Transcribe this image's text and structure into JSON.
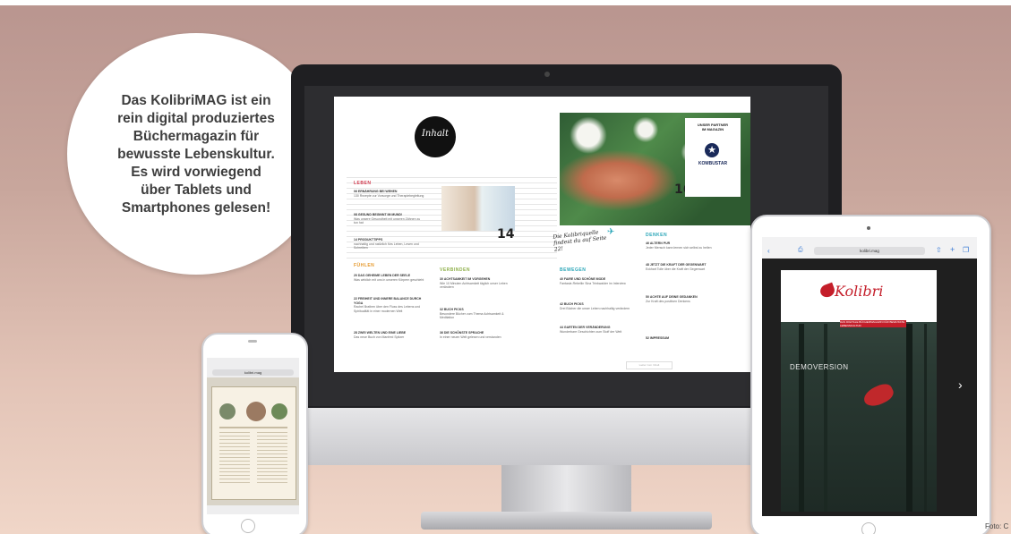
{
  "bubble": {
    "text": "Das KolibriMAG ist ein\nrein digital produziertes\nBüchermagazin für\nbewusste Lebenskultur.\nEs wird vorwiegend\nüber Tablets und\nSmartphones gelesen!"
  },
  "magazine": {
    "logo_text": "Inhalt",
    "sections": [
      {
        "label": "LEBEN",
        "color": "#d23b4f"
      },
      {
        "label": "FÜHLEN",
        "color": "#e69a2e"
      },
      {
        "label": "VERBINDEN",
        "color": "#8fb04b"
      },
      {
        "label": "BEWEGEN",
        "color": "#2aa6b8"
      },
      {
        "label": "DENKEN",
        "color": "#2aa6b8"
      }
    ],
    "page_numbers": [
      "14",
      "16"
    ],
    "partner_title": "UNSER PARTNER\nIM MAGAZIN",
    "partner_name": "KOMBUSTAR",
    "script_note": "Die Kolibriquelle findest du auf Seite 22!",
    "more_button": "weiter zum Inhalt",
    "toc_items": [
      {
        "num": "06",
        "title": "ERNÄHRUNG BEI WEHEN",
        "text": "130 Rezepte zur Vorsorge und Therapiebegleitung"
      },
      {
        "num": "08",
        "title": "GESUND BEGINNT IM MUND!",
        "text": "Was unsere Gesundheit mit unseren Zähnen zu tun hat"
      },
      {
        "num": "14",
        "title": "PRODUKTTIPPS",
        "text": "nachhaltig und natürlich fürs Leben, Lesen und Schreiben"
      },
      {
        "num": "20",
        "title": "DAS GEHEIME LEBEN DER SEELE",
        "text": "Was wirklich mit uns in unseren Körpern geschieht"
      },
      {
        "num": "22",
        "title": "FREIHEIT UND INNERE BALANCE DURCH YOGA",
        "text": "Rachel Brathen über den Fluss des Lebens und Spiritualität in einer modernen Welt"
      },
      {
        "num": "28",
        "title": "ZWEI WELTEN UND EINE LIEBE",
        "text": "Das neue Buch von Manfred Spitzer"
      },
      {
        "num": "30",
        "title": "ACHTSAMKEIT IM VORGEHEN",
        "text": "Wie 10 Minuten Achtsamkeit täglich unser Leben verändern"
      },
      {
        "num": "32",
        "title": "BUCH PICKS",
        "text": "Besondere Bücher zum Thema Achtsamkeit & Meditation"
      },
      {
        "num": "36",
        "title": "DIE SCHÖNSTE SPRACHE",
        "text": "In einer neuen Welt gelesen und verstanden"
      },
      {
        "num": "40",
        "title": "FAIRE UND SCHÖNE MODE",
        "text": "Fantasie-Rebellin Sina Trinkwalder im Interview"
      },
      {
        "num": "42",
        "title": "BUCH PICKS",
        "text": "Drei Bücher die unser Leben nachhaltig verändern"
      },
      {
        "num": "44",
        "title": "GARTEN DER VERÄNDERUNG",
        "text": "Wunderbare Geschichten zum Stoff der Welt"
      },
      {
        "num": "46",
        "title": "ALTERN PUR",
        "text": "Jeder Mensch kann lernen sich selbst zu heilen"
      },
      {
        "num": "48",
        "title": "JETZT DIE KRAFT DER GEGENWART",
        "text": "Eckhart Tolle über die Kraft der Gegenwart"
      },
      {
        "num": "50",
        "title": "ACHTE AUF DEINE GEDANKEN",
        "text": "Zur Kraft des positiven Denkens"
      },
      {
        "num": "52",
        "title": "IMPRESSUM",
        "text": ""
      }
    ]
  },
  "iphone": {
    "url": "kolibri.mag"
  },
  "ipad": {
    "url": "kolibri.mag",
    "cover_brand": "Kolibri",
    "cover_banner": "DAS DIGITALE BÜCHERMAGAZIN FÜR BEWUSSTE LEBENSKULTUR",
    "demo_label": "DEMOVERSION"
  },
  "photo_credit": "Foto: C"
}
